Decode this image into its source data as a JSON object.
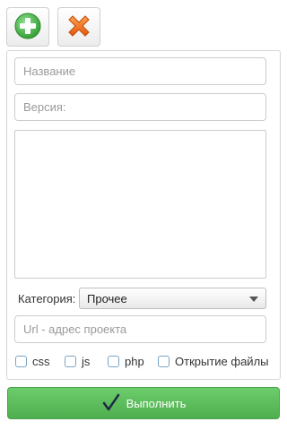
{
  "toolbar": {
    "add_icon": "plus-circle-icon",
    "close_icon": "close-x-icon",
    "add_color": "#3fae3f",
    "close_color": "#f07a1a"
  },
  "form": {
    "name_placeholder": "Название",
    "version_placeholder": "Версия:",
    "description_value": "",
    "category_label": "Категория:",
    "category_selected": "Прочее",
    "url_placeholder": "Url - адрес проекта",
    "checkboxes": [
      {
        "label": "css",
        "checked": false
      },
      {
        "label": "js",
        "checked": false
      },
      {
        "label": "php",
        "checked": false
      },
      {
        "label": "Открытие файлы",
        "checked": false
      }
    ]
  },
  "submit": {
    "label": "Выполнить",
    "icon": "checkmark-icon",
    "color": "#5cbd5c"
  }
}
